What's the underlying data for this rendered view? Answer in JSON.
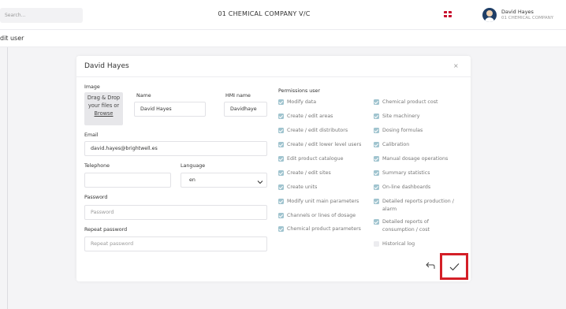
{
  "header": {
    "search_placeholder": "Search...",
    "company_title": "01 CHEMICAL COMPANY V/C",
    "flag_icon": "uk-flag-icon",
    "user": {
      "name": "David Hayes",
      "company": "01 CHEMICAL COMPANY"
    }
  },
  "page": {
    "title": "dit user"
  },
  "modal": {
    "title": "David Hayes",
    "close_label": "×",
    "image": {
      "label": "Image",
      "drop_line1": "Drag & Drop",
      "drop_line2": "your files or",
      "browse": "Browse"
    },
    "name": {
      "label": "Name",
      "value": "David Hayes"
    },
    "hmi_name": {
      "label": "HMI name",
      "value": "Davidhaye"
    },
    "email": {
      "label": "Email",
      "value": "david.hayes@brightwell.es"
    },
    "telephone": {
      "label": "Telephone",
      "value": ""
    },
    "language": {
      "label": "Language",
      "value": "en"
    },
    "password": {
      "label": "Password",
      "placeholder": "Password"
    },
    "repeat_password": {
      "label": "Repeat password",
      "placeholder": "Repeat password"
    },
    "permissions": {
      "label": "Permissions user",
      "left": [
        {
          "label": "Modify data",
          "checked": true
        },
        {
          "label": "Create / edit areas",
          "checked": true
        },
        {
          "label": "Create / edit distributors",
          "checked": true
        },
        {
          "label": "Create / edit lower level users",
          "checked": true
        },
        {
          "label": "Edit product catalogue",
          "checked": true
        },
        {
          "label": "Create / edit sites",
          "checked": true
        },
        {
          "label": "Create units",
          "checked": true
        },
        {
          "label": "Modify unit main parameters",
          "checked": true
        },
        {
          "label": "Channels or lines of dosage",
          "checked": true
        },
        {
          "label": "Chemical product parameters",
          "checked": true
        }
      ],
      "right": [
        {
          "label": "Chemical product cost",
          "checked": true
        },
        {
          "label": "Site machinery",
          "checked": true
        },
        {
          "label": "Dosing formulas",
          "checked": true
        },
        {
          "label": "Calibration",
          "checked": true
        },
        {
          "label": "Manual dosage operations",
          "checked": true
        },
        {
          "label": "Summary statistics",
          "checked": true
        },
        {
          "label": "On-line dashboards",
          "checked": true
        },
        {
          "label": "Detailed reports production /",
          "label2": "alarm",
          "checked": true
        },
        {
          "label": "Detailed reports of",
          "label2": "consumption / cost",
          "checked": true
        },
        {
          "label": "Historical log",
          "checked": false
        }
      ]
    },
    "actions": {
      "undo_icon": "undo-arrow-icon",
      "save_icon": "checkmark-icon"
    }
  },
  "colors": {
    "checkbox_checked": "#a0c4cf",
    "highlight_border": "#d41f27"
  }
}
